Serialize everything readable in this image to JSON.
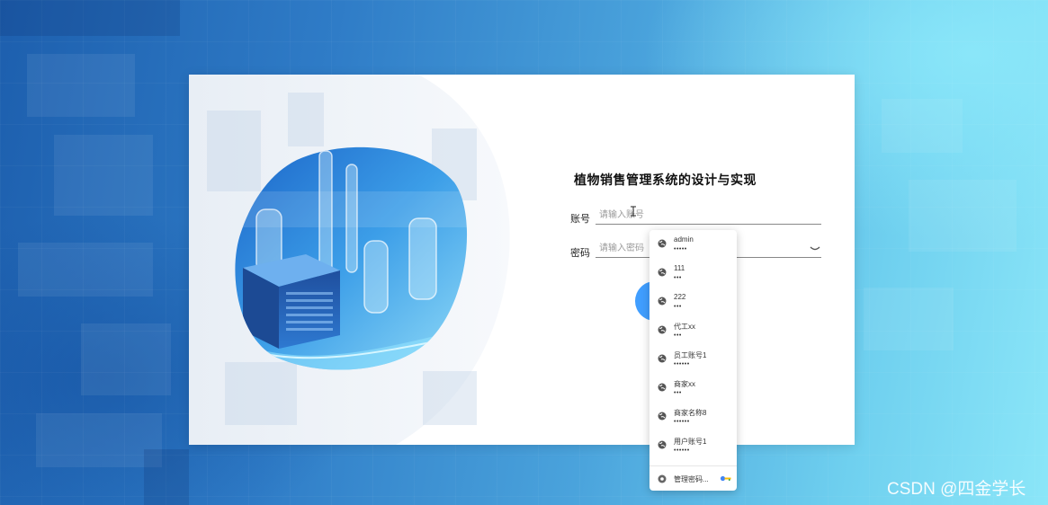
{
  "login": {
    "title": "植物销售管理系统的设计与实现",
    "account_label": "账号",
    "account_placeholder": "请输入账号",
    "password_label": "密码",
    "password_placeholder": "请输入密码"
  },
  "autofill": {
    "items": [
      {
        "user": "admin",
        "pass": "•••••"
      },
      {
        "user": "111",
        "pass": "•••"
      },
      {
        "user": "222",
        "pass": "•••"
      },
      {
        "user": "代工xx",
        "pass": "•••"
      },
      {
        "user": "员工账号1",
        "pass": "••••••"
      },
      {
        "user": "商家xx",
        "pass": "•••"
      },
      {
        "user": "商家名称8",
        "pass": "••••••"
      },
      {
        "user": "用户账号1",
        "pass": "••••••"
      }
    ],
    "manage_label": "管理密码...",
    "item_icon": "globe-icon"
  },
  "watermark": "CSDN @四金学长",
  "colors": {
    "accent": "#409eff",
    "background_start": "#1d5fae",
    "background_end": "#8be6f8"
  }
}
